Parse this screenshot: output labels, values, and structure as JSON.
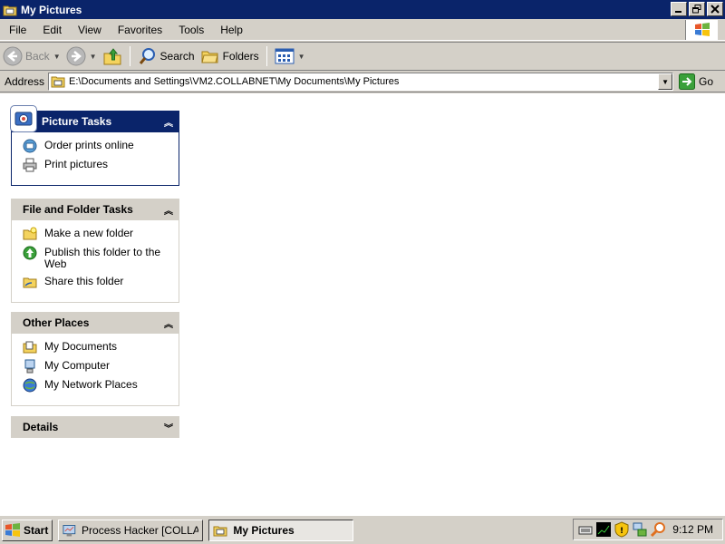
{
  "window": {
    "title": "My Pictures"
  },
  "menu": {
    "items": [
      "File",
      "Edit",
      "View",
      "Favorites",
      "Tools",
      "Help"
    ]
  },
  "toolbar": {
    "back_label": "Back",
    "search_label": "Search",
    "folders_label": "Folders"
  },
  "address": {
    "label": "Address",
    "value": "E:\\Documents and Settings\\VM2.COLLABNET\\My Documents\\My Pictures",
    "go_label": "Go"
  },
  "panels": {
    "picture_tasks": {
      "title": "Picture Tasks",
      "items": [
        "Order prints online",
        "Print pictures"
      ]
    },
    "file_folder_tasks": {
      "title": "File and Folder Tasks",
      "items": [
        "Make a new folder",
        "Publish this folder to the Web",
        "Share this folder"
      ]
    },
    "other_places": {
      "title": "Other Places",
      "items": [
        "My Documents",
        "My Computer",
        "My Network Places"
      ]
    },
    "details": {
      "title": "Details"
    }
  },
  "taskbar": {
    "start_label": "Start",
    "tasks": [
      "Process Hacker [COLLA...",
      "My Pictures"
    ],
    "clock": "9:12 PM"
  },
  "colors": {
    "title_bar": "#0a246a",
    "chrome": "#d4d0c8",
    "content_bg": "#ffffff"
  }
}
